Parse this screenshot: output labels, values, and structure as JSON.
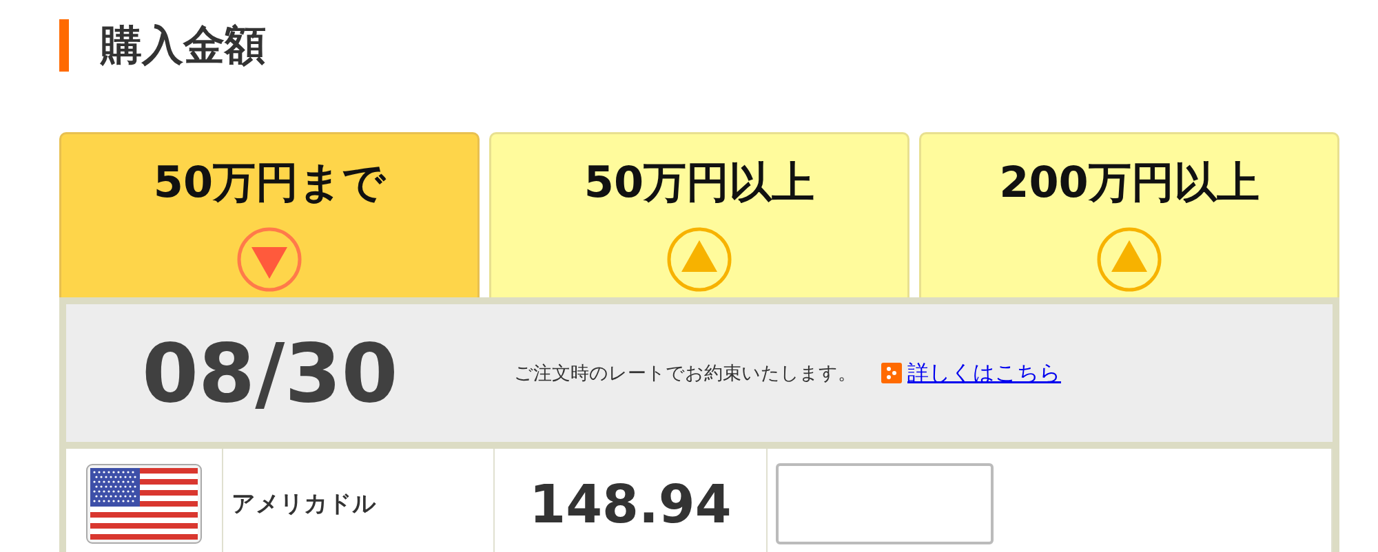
{
  "heading": "購入金額",
  "tabs": [
    {
      "label": "50万円まで",
      "selected": true
    },
    {
      "label": "50万円以上",
      "selected": false
    },
    {
      "label": "200万円以上",
      "selected": false
    }
  ],
  "info": {
    "date": "08/30",
    "note": "ご注文時のレートでお約束いたします。",
    "link": "詳しくはこちら"
  },
  "rows": [
    {
      "currency": "アメリカドル",
      "rate": "148.94",
      "amount": ""
    }
  ]
}
